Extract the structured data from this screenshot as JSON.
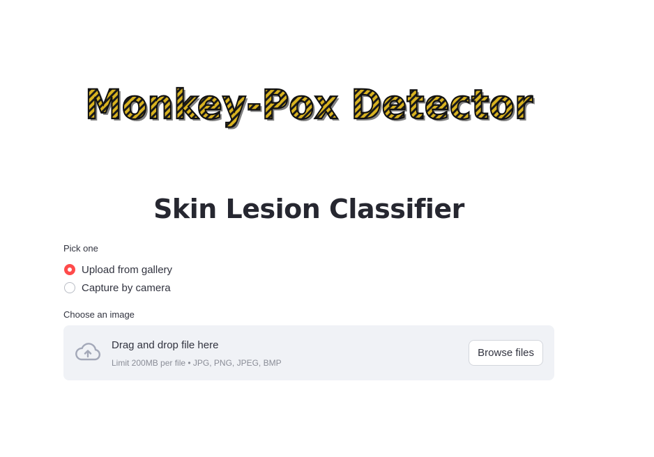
{
  "logo": {
    "text": "Monkey-Pox Detector",
    "colors": {
      "stripe_a": "#d9b320",
      "stripe_b": "#1a1a1a",
      "outline": "#111111"
    }
  },
  "main": {
    "title": "Skin Lesion Classifier",
    "radio": {
      "label": "Pick one",
      "options": [
        "Upload from gallery",
        "Capture by camera"
      ],
      "selected": "Upload from gallery"
    },
    "uploader": {
      "label": "Choose an image",
      "drag_text": "Drag and drop file here",
      "limit_text": "Limit 200MB per file • JPG, PNG, JPEG, BMP",
      "button_label": "Browse files",
      "icon": "cloud-upload-icon"
    }
  },
  "colors": {
    "accent": "#ff4b4b",
    "dropzone_bg": "#f0f2f6",
    "text": "#31333f"
  }
}
